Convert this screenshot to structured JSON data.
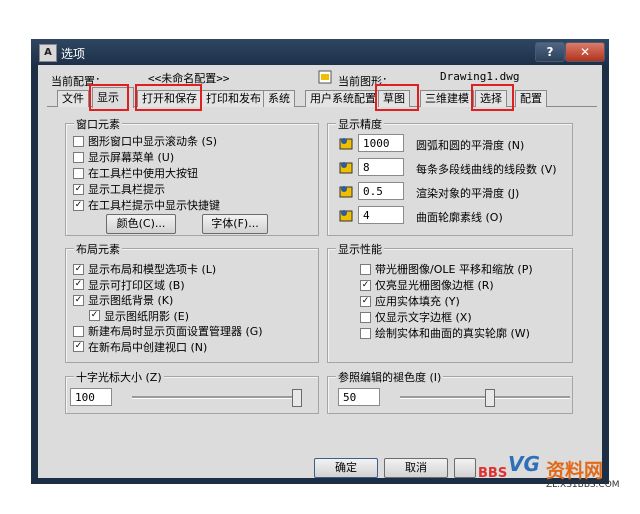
{
  "window": {
    "title": "选项",
    "help_symbol": "?",
    "close_symbol": "✕",
    "app_icon_letter": "A"
  },
  "header": {
    "current_profile_label": "当前配置：",
    "current_profile_value": "<<未命名配置>>",
    "current_drawing_label": "当前图形：",
    "current_drawing_value": "Drawing1.dwg"
  },
  "tabs": [
    "文件",
    "显示",
    "打开和保存",
    "打印和发布",
    "系统",
    "用户系统配置",
    "草图",
    "三维建模",
    "选择",
    "配置"
  ],
  "active_tab": "显示",
  "window_elements": {
    "title": "窗口元素",
    "items": [
      {
        "label": "图形窗口中显示滚动条 (S)",
        "checked": false
      },
      {
        "label": "显示屏幕菜单 (U)",
        "checked": false
      },
      {
        "label": "在工具栏中使用大按钮",
        "checked": false
      },
      {
        "label": "显示工具栏提示",
        "checked": true
      },
      {
        "label": "在工具栏提示中显示快捷键",
        "checked": true
      }
    ],
    "colors_button": "颜色(C)...",
    "fonts_button": "字体(F)..."
  },
  "display_resolution": {
    "title": "显示精度",
    "items": [
      {
        "value": "1000",
        "label": "圆弧和圆的平滑度 (N)"
      },
      {
        "value": "8",
        "label": "每条多段线曲线的线段数 (V)"
      },
      {
        "value": "0.5",
        "label": "渲染对象的平滑度 (J)"
      },
      {
        "value": "4",
        "label": "曲面轮廓素线 (O)"
      }
    ]
  },
  "layout_elements": {
    "title": "布局元素",
    "items": [
      {
        "label": "显示布局和模型选项卡 (L)",
        "checked": true
      },
      {
        "label": "显示可打印区域 (B)",
        "checked": true
      },
      {
        "label": "显示图纸背景 (K)",
        "checked": true
      },
      {
        "label": "显示图纸阴影 (E)",
        "checked": true
      },
      {
        "label": "新建布局时显示页面设置管理器 (G)",
        "checked": false
      },
      {
        "label": "在新布局中创建视口 (N)",
        "checked": true
      }
    ]
  },
  "display_performance": {
    "title": "显示性能",
    "items": [
      {
        "label": "带光栅图像/OLE 平移和缩放 (P)",
        "checked": false
      },
      {
        "label": "仅亮显光栅图像边框 (R)",
        "checked": true
      },
      {
        "label": "应用实体填充 (Y)",
        "checked": true
      },
      {
        "label": "仅显示文字边框 (X)",
        "checked": false
      },
      {
        "label": "绘制实体和曲面的真实轮廓 (W)",
        "checked": false
      }
    ]
  },
  "crosshair": {
    "title": "十字光标大小 (Z)",
    "value": "100",
    "slider_fraction": 1.0
  },
  "xref_fade": {
    "title": "参照编辑的褪色度 (I)",
    "value": "50",
    "slider_fraction": 0.5
  },
  "footer": {
    "ok": "确定",
    "cancel": "取消"
  },
  "watermark": {
    "logo_text": "VG",
    "site_text": "资料网",
    "sub_text": "BBS",
    "url": "ZL.XS1BBS.COM"
  },
  "colors": {
    "highlight_border": "#e02020",
    "titlebar": "#1d2f45",
    "dialog_bg": "#dcdcdc"
  }
}
